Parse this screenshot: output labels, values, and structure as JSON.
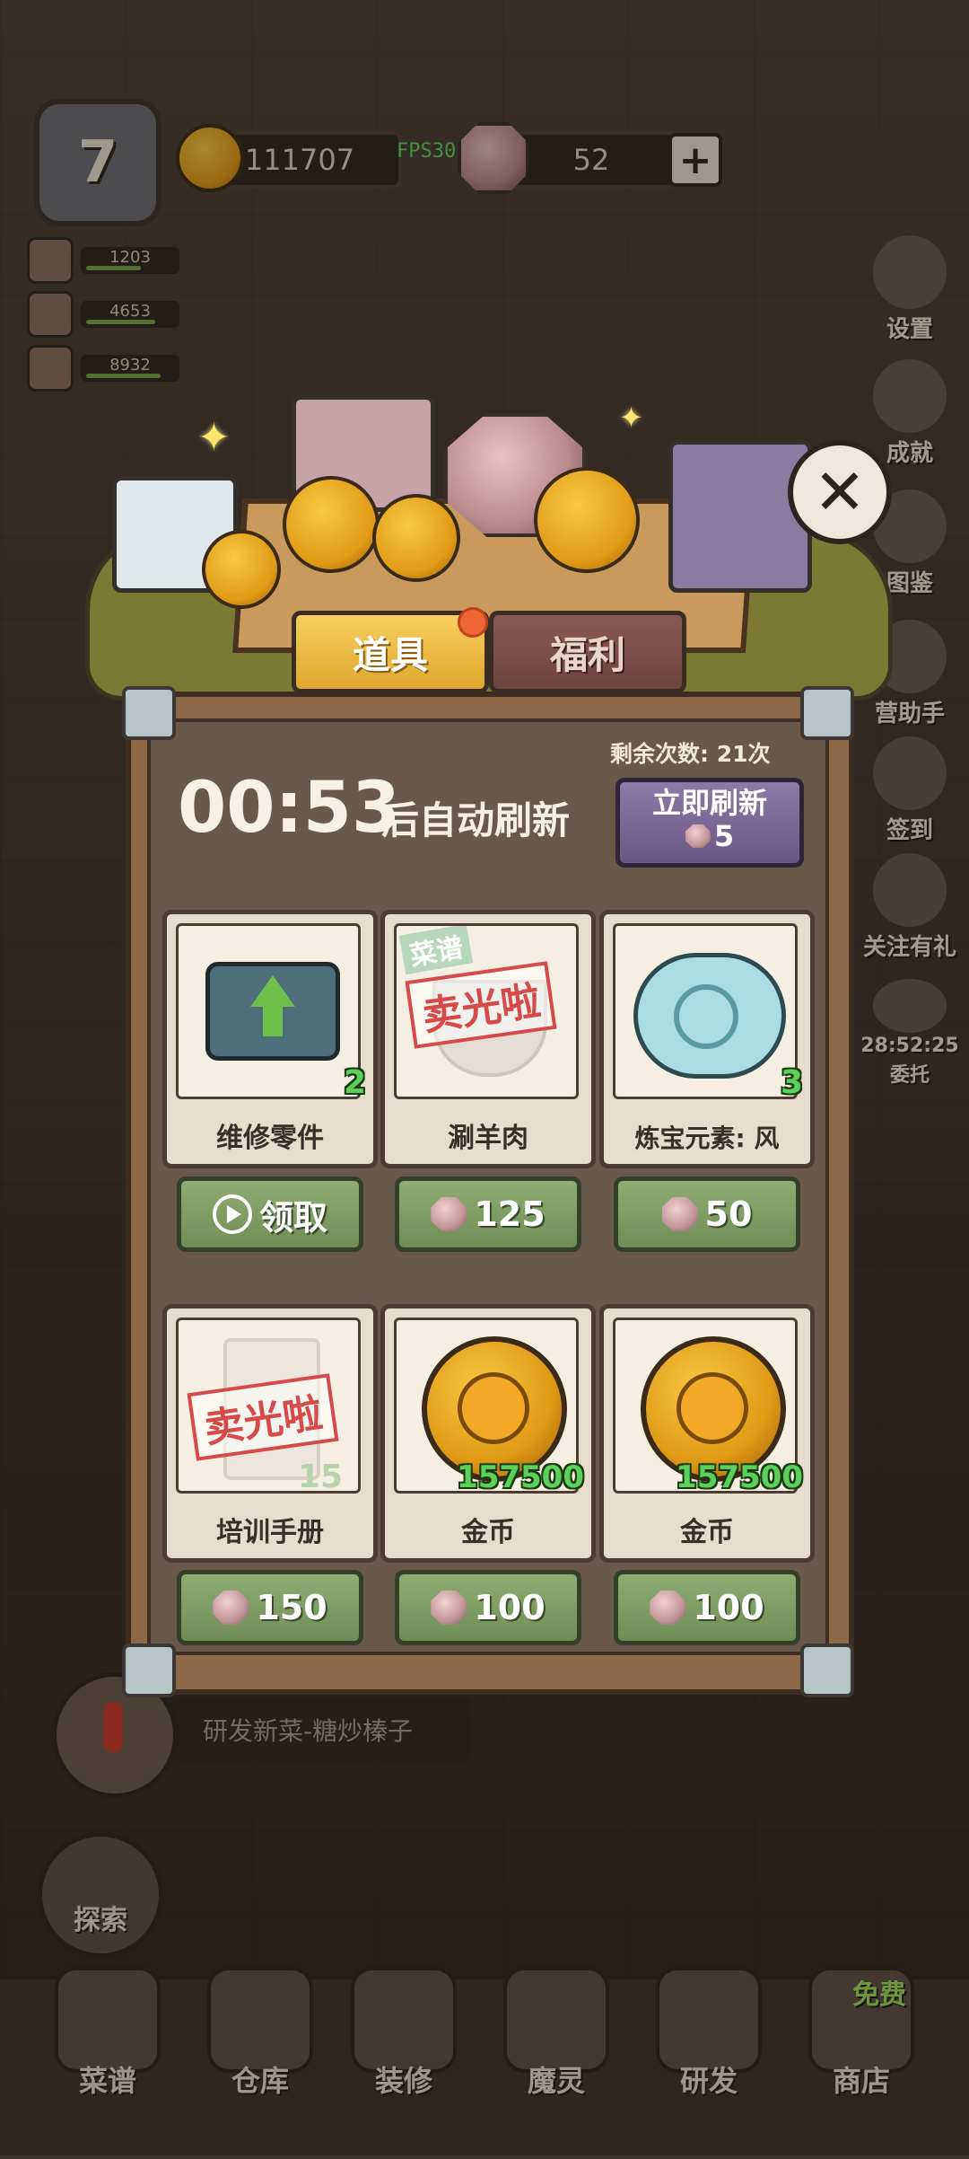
{
  "hud": {
    "level": "7",
    "coins": "111707",
    "fps": "FPS30",
    "gems": "52",
    "plus": "+"
  },
  "stats": [
    {
      "value": "1203",
      "fill": 0.55
    },
    {
      "value": "4653",
      "fill": 0.7
    },
    {
      "value": "8932",
      "fill": 0.75
    }
  ],
  "side_menu": {
    "settings": "设置",
    "achievements": "成就",
    "collection": "图鉴",
    "assistant": "营助手",
    "checkin": "签到",
    "follow": "关注有礼",
    "commission_time": "28:52:25",
    "commission": "委托"
  },
  "tabs": {
    "items": "道具",
    "welfare": "福利"
  },
  "shop": {
    "remaining": "剩余次数: 21次",
    "timer": "00:53",
    "timer_suffix": "后自动刷新",
    "refresh_label": "立即刷新",
    "refresh_cost": "5",
    "soldout_stamp": "卖光啦",
    "recipe_tag": "菜谱",
    "cards": [
      {
        "name": "维修零件",
        "qty": "2",
        "button": "领取",
        "icon": "chip-icon"
      },
      {
        "name": "涮羊肉",
        "qty": "",
        "button": "125",
        "icon": "bowl-icon",
        "sold_out": true
      },
      {
        "name": "炼宝元素: 风",
        "qty": "3",
        "button": "50",
        "icon": "wind-element-icon"
      },
      {
        "name": "培训手册",
        "qty": "15",
        "button": "150",
        "icon": "manual-icon",
        "sold_out": true
      },
      {
        "name": "金币",
        "qty": "157500",
        "button": "100",
        "icon": "gold-coin-icon"
      },
      {
        "name": "金币",
        "qty": "157500",
        "button": "100",
        "icon": "gold-coin-icon"
      }
    ]
  },
  "quest": {
    "text": "研发新菜-糖炒榛子"
  },
  "explore": "探索",
  "nav": {
    "recipes": "菜谱",
    "warehouse": "仓库",
    "decorate": "装修",
    "spirits": "魔灵",
    "research": "研发",
    "shop": "商店",
    "free": "免费"
  },
  "colors": {
    "accent_gold": "#e0a72c",
    "price_green": "#7a9a62",
    "refresh_purple": "#7a6694",
    "panel_brown": "#6a5949"
  }
}
